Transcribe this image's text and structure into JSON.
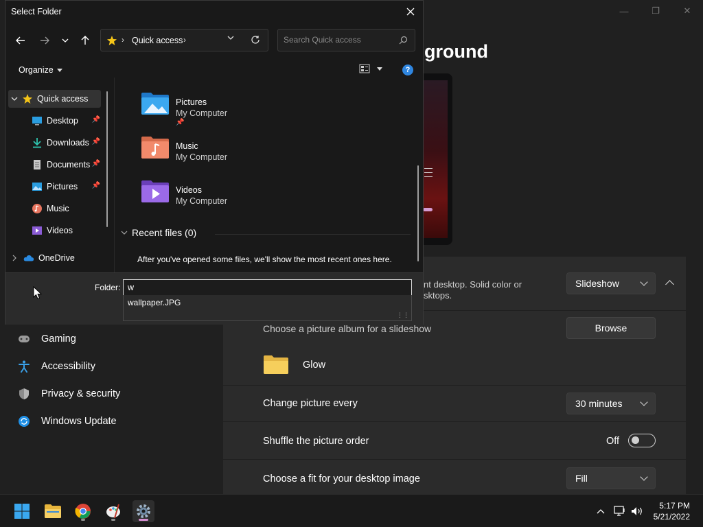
{
  "settings": {
    "heading_fragment": "ground",
    "sidebar": [
      {
        "label": "Gaming",
        "icon": "gamepad-icon"
      },
      {
        "label": "Accessibility",
        "icon": "accessibility-icon"
      },
      {
        "label": "Privacy & security",
        "icon": "shield-icon"
      },
      {
        "label": "Windows Update",
        "icon": "refresh-icon"
      }
    ],
    "slideshow_desc_line1": "nt desktop. Solid color or",
    "slideshow_desc_line2": "sktops.",
    "slideshow_select": "Slideshow",
    "album_label": "Choose a picture album for a slideshow",
    "browse_label": "Browse",
    "album_folder": "Glow",
    "change_label": "Change picture every",
    "change_value": "30 minutes",
    "shuffle_label": "Shuffle the picture order",
    "shuffle_state": "Off",
    "fit_label": "Choose a fit for your desktop image",
    "fit_value": "Fill"
  },
  "dialog": {
    "title": "Select Folder",
    "address": "Quick access",
    "search_placeholder": "Search Quick access",
    "organize": "Organize",
    "nav": [
      {
        "label": "Quick access",
        "icon": "star-icon",
        "pinned": false
      },
      {
        "label": "Desktop",
        "icon": "desktop-icon",
        "pinned": true
      },
      {
        "label": "Downloads",
        "icon": "download-icon",
        "pinned": true
      },
      {
        "label": "Documents",
        "icon": "document-icon",
        "pinned": true
      },
      {
        "label": "Pictures",
        "icon": "pictures-icon",
        "pinned": true
      },
      {
        "label": "Music",
        "icon": "music-icon",
        "pinned": false
      },
      {
        "label": "Videos",
        "icon": "videos-icon",
        "pinned": false
      },
      {
        "label": "OneDrive",
        "icon": "cloud-icon",
        "pinned": false
      }
    ],
    "quick_items": [
      {
        "name": "Pictures",
        "location": "My Computer",
        "pinned": true
      },
      {
        "name": "Music",
        "location": "My Computer",
        "pinned": false
      },
      {
        "name": "Videos",
        "location": "My Computer",
        "pinned": false
      }
    ],
    "recent_heading": "Recent files (0)",
    "recent_message": "After you've opened some files, we'll show the most recent ones here.",
    "folder_label": "Folder:",
    "folder_value": "w",
    "suggestion": "wallpaper.JPG"
  },
  "taskbar": {
    "time": "5:17 PM",
    "date": "5/21/2022",
    "apps": [
      "start-icon",
      "file-explorer-icon",
      "chrome-icon",
      "paint-icon",
      "settings-icon"
    ]
  },
  "colors": {
    "accent": "#2f86e0",
    "star": "#f5c518",
    "folder": "#f2c94c"
  }
}
